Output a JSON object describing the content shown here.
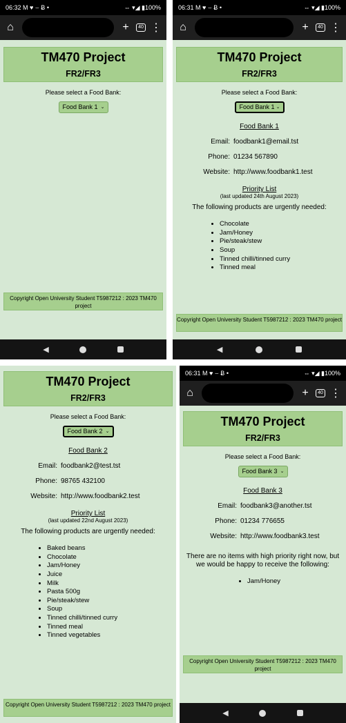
{
  "page": {
    "title": "TM470 Project",
    "subtitle": "FR2/FR3",
    "select_label": "Please select a Food Bank:",
    "footer": "Copyright Open University Student T5987212 : 2023 TM470 project",
    "labels": {
      "email": "Email:",
      "phone": "Phone:",
      "website": "Website:"
    },
    "priority_title": "Priority List",
    "urgent_intro": "The following products are urgently needed:"
  },
  "status_bars": [
    {
      "time": "06:32",
      "icons": "M ♥ ⌣ Ƀ •",
      "right": "⇔ ▾◢ ▮100%"
    },
    {
      "time": "06:31",
      "icons": "M ♥ ⌣ Ƀ •",
      "right": "⇔ ▾◢ ▮100%"
    },
    {
      "time": "06:31",
      "icons": "M ♥ ⌣ Ƀ •",
      "right": "⇔ ▾◢ ▮100%"
    }
  ],
  "toolbar": {
    "home_icon": "⌂",
    "new_tab": "+",
    "tab_count": "40",
    "menu": "⋮"
  },
  "nav_bar": {
    "back": "◀"
  },
  "screens": [
    {
      "selected": "Food Bank 1"
    },
    {
      "selected": "Food Bank 1",
      "bank": {
        "name": "Food Bank 1",
        "email": "foodbank1@email.tst",
        "phone": "01234 567890",
        "website": "http://www.foodbank1.test"
      },
      "updated": "(last updated 24th August 2023)",
      "items": [
        "Chocolate",
        "Jam/Honey",
        "Pie/steak/stew",
        "Soup",
        "Tinned chilli/tinned curry",
        "Tinned meal"
      ]
    },
    {
      "selected": "Food Bank 2",
      "bank": {
        "name": "Food Bank 2",
        "email": "foodbank2@test.tst",
        "phone": "98765 432100",
        "website": "http://www.foodbank2.test"
      },
      "updated": "(last updated 22nd August 2023)",
      "items": [
        "Baked beans",
        "Chocolate",
        "Jam/Honey",
        "Juice",
        "Milk",
        "Pasta 500g",
        "Pie/steak/stew",
        "Soup",
        "Tinned chilli/tinned curry",
        "Tinned meal",
        "Tinned vegetables"
      ]
    },
    {
      "selected": "Food Bank 3",
      "bank": {
        "name": "Food Bank 3",
        "email": "foodbank3@another.tst",
        "phone": "01234 776655",
        "website": "http://www.foodbank3.test"
      },
      "no_priority": "There are no items with high priority right now, but we would be happy to receive the following:",
      "items": [
        "Jam/Honey"
      ]
    }
  ]
}
